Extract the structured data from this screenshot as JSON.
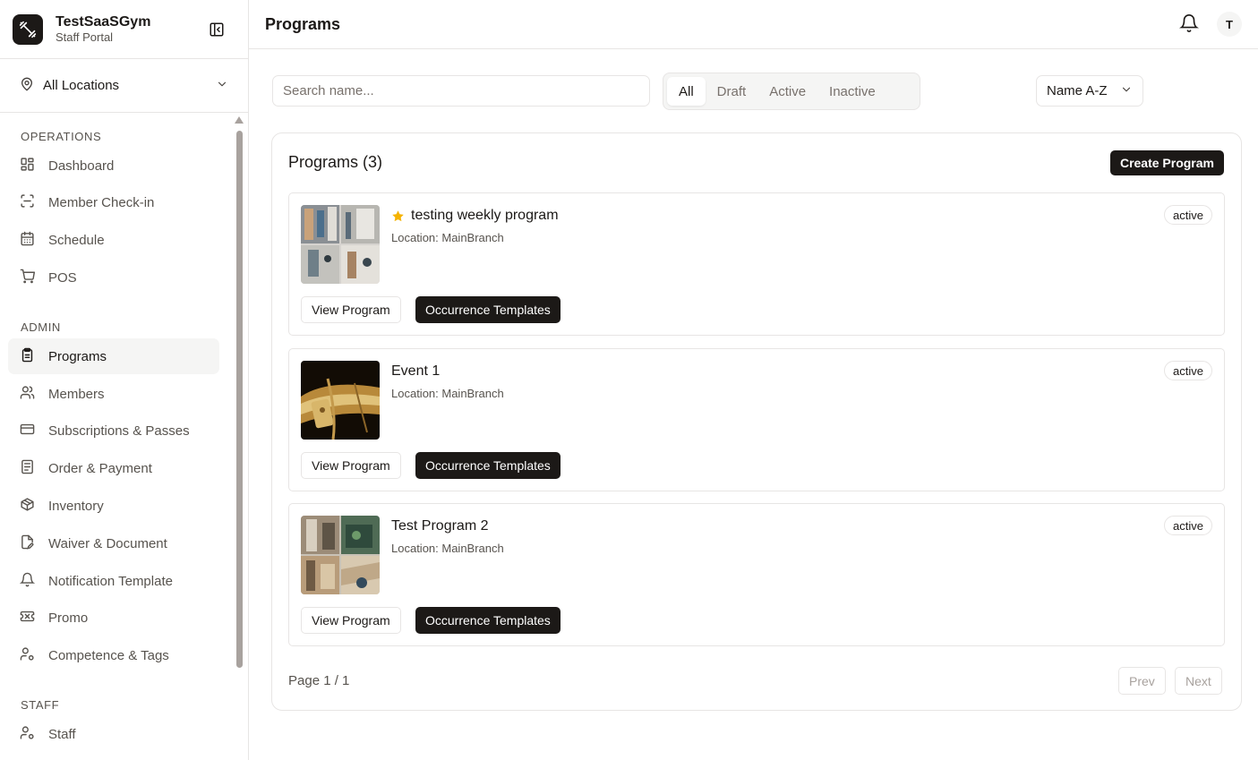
{
  "brand": {
    "name": "TestSaaSGym",
    "subtitle": "Staff Portal"
  },
  "location": {
    "label": "All Locations"
  },
  "nav": {
    "operations_title": "OPERATIONS",
    "admin_title": "ADMIN",
    "staff_title": "STAFF",
    "items": [
      {
        "label": "Dashboard",
        "icon": "grid-icon"
      },
      {
        "label": "Member Check-in",
        "icon": "scan-icon"
      },
      {
        "label": "Schedule",
        "icon": "calendar-icon"
      },
      {
        "label": "POS",
        "icon": "cart-icon"
      },
      {
        "label": "Programs",
        "icon": "clipboard-icon",
        "active": true
      },
      {
        "label": "Members",
        "icon": "users-icon"
      },
      {
        "label": "Subscriptions & Passes",
        "icon": "credit-card-icon"
      },
      {
        "label": "Order & Payment",
        "icon": "receipt-icon"
      },
      {
        "label": "Inventory",
        "icon": "package-icon"
      },
      {
        "label": "Waiver & Document",
        "icon": "file-edit-icon"
      },
      {
        "label": "Notification Template",
        "icon": "bell-icon"
      },
      {
        "label": "Promo",
        "icon": "ticket-icon"
      },
      {
        "label": "Competence & Tags",
        "icon": "user-cog-icon"
      },
      {
        "label": "Staff",
        "icon": "user-cog-icon"
      }
    ]
  },
  "header": {
    "title": "Programs",
    "avatar_initial": "T"
  },
  "search": {
    "placeholder": "Search name...",
    "value": ""
  },
  "filters": {
    "tabs": [
      "All",
      "Draft",
      "Active",
      "Inactive"
    ],
    "selected": "All"
  },
  "sort": {
    "value": "Name A-Z"
  },
  "programs_panel": {
    "title": "Programs (3)",
    "create_label": "Create Program",
    "view_label": "View Program",
    "templates_label": "Occurrence Templates",
    "items": [
      {
        "name": "testing weekly program",
        "location": "Location: MainBranch",
        "status": "active",
        "featured": true
      },
      {
        "name": "Event 1",
        "location": "Location: MainBranch",
        "status": "active",
        "featured": false
      },
      {
        "name": "Test Program 2",
        "location": "Location: MainBranch",
        "status": "active",
        "featured": false
      }
    ]
  },
  "pagination": {
    "info": "Page 1 / 1",
    "prev": "Prev",
    "next": "Next"
  },
  "colors": {
    "primary": "#1c1917",
    "muted": "#57534e",
    "border": "#e7e5e4",
    "star": "#f5b301"
  }
}
